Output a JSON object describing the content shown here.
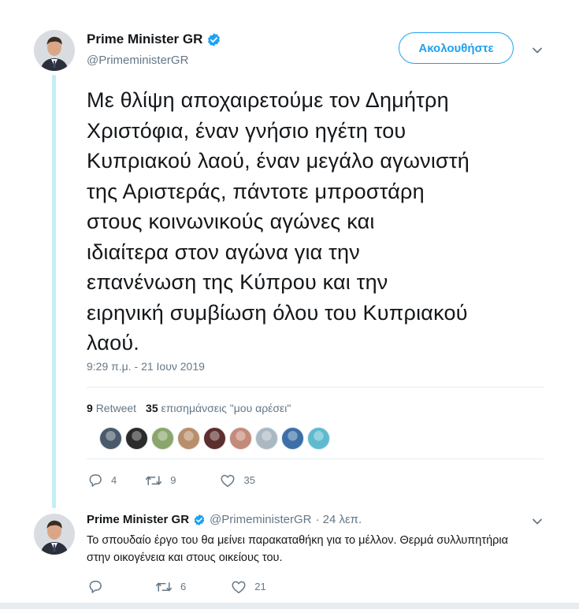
{
  "main_tweet": {
    "display_name": "Prime Minister GR",
    "handle": "@PrimeministerGR",
    "follow_label": "Ακολουθήστε",
    "text_lines": [
      "Με θλίψη αποχαιρετούμε τον Δημήτρη",
      "Χριστόφια, έναν γνήσιο ηγέτη του",
      "Κυπριακού λαού, έναν μεγάλο αγωνιστή",
      "της Αριστεράς, πάντοτε μπροστάρη",
      "στους κοινωνικούς αγώνες και",
      "ιδιαίτερα στον αγώνα για την",
      "επανένωση της Κύπρου και την",
      "ειρηνική συμβίωση όλου του Κυπριακού",
      "λαού."
    ],
    "timestamp": "9:29 π.μ. - 21 Ιουν 2019",
    "retweet_count": "9",
    "retweet_label": "Retweet",
    "like_count": "35",
    "like_label": "επισημάνσεις \"μου αρέσει\"",
    "likers": [
      {
        "icon": "avatar-liker-1",
        "color": "#4a5a6a"
      },
      {
        "icon": "avatar-liker-2",
        "color": "#2b2b2b"
      },
      {
        "icon": "avatar-liker-3",
        "color": "#8aa66b"
      },
      {
        "icon": "avatar-liker-4",
        "color": "#b98e6a"
      },
      {
        "icon": "avatar-liker-5",
        "color": "#5c2e2e"
      },
      {
        "icon": "avatar-liker-6",
        "color": "#c48a7a"
      },
      {
        "icon": "avatar-liker-7",
        "color": "#aab8c2"
      },
      {
        "icon": "avatar-liker-8",
        "color": "#3c6fa8"
      },
      {
        "icon": "avatar-liker-9",
        "color": "#5fbad0"
      }
    ],
    "actions": {
      "reply_count": "4",
      "retweet_count": "9",
      "like_count": "35"
    }
  },
  "reply_tweet": {
    "display_name": "Prime Minister GR",
    "handle": "@PrimeministerGR",
    "time": "· 24 λεπ.",
    "text": "Το σπουδαίο έργο του θα μείνει παρακαταθήκη για το μέλλον. Θερμά συλλυπητήρια στην οικογένεια και στους οικείους του.",
    "actions": {
      "reply_count": "",
      "retweet_count": "6",
      "like_count": "21"
    }
  },
  "colors": {
    "accent": "#1da1f2",
    "thread_line": "#c4eef5",
    "secondary_text": "#657786"
  }
}
